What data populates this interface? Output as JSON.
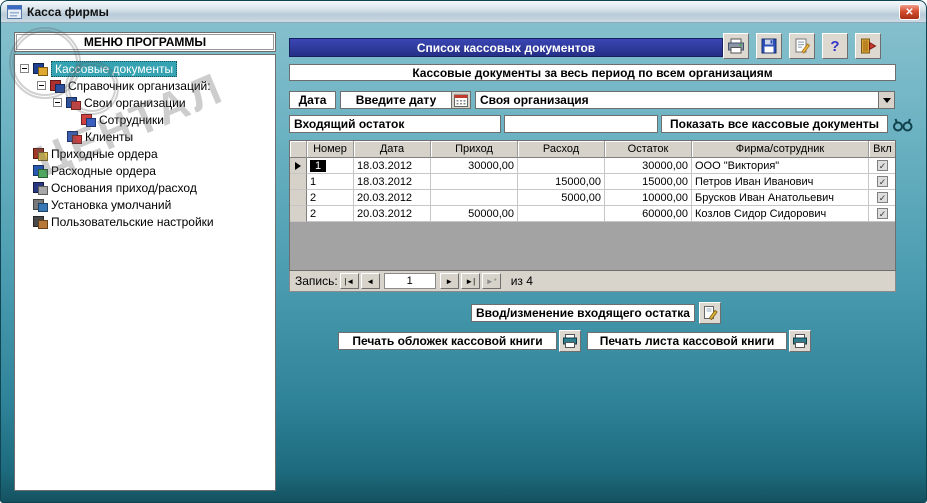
{
  "window": {
    "title": "Касса фирмы",
    "close": "✕"
  },
  "watermark": {
    "text": "ЦЕНТАЛ"
  },
  "colors": {
    "desktop_teal": "#4b9cb0",
    "header_blue": "#2c379f",
    "selection_teal": "#35a3b2",
    "close_red": "#d44e2e"
  },
  "menu": {
    "header": "МЕНЮ ПРОГРАММЫ",
    "items": [
      {
        "label": "Кассовые документы"
      },
      {
        "label": "Справочник организаций:"
      },
      {
        "label": "Свои организации"
      },
      {
        "label": "Сотрудники"
      },
      {
        "label": "Клиенты"
      },
      {
        "label": "Приходные ордера"
      },
      {
        "label": "Расходные ордера"
      },
      {
        "label": "Основания приход/расход"
      },
      {
        "label": "Установка умолчаний"
      },
      {
        "label": "Пользовательские настройки"
      }
    ]
  },
  "toolbar": {
    "icons": [
      "print",
      "save",
      "form-edit",
      "help",
      "exit"
    ],
    "help_glyph": "?"
  },
  "main": {
    "list_header": "Список кассовых документов",
    "period_header": "Кассовые документы за весь период по всем организациям",
    "filters": {
      "date_label": "Дата",
      "date_value": "Введите дату",
      "org_value": "Своя организация",
      "incoming_label": "Входящий остаток",
      "incoming_value": "",
      "show_all_label": "Показать все кассовые документы"
    },
    "table": {
      "columns": [
        "Номер",
        "Дата",
        "Приход",
        "Расход",
        "Остаток",
        "Фирма/сотрудник",
        "Вкл"
      ],
      "rows": [
        {
          "num": "1",
          "date": "18.03.2012",
          "in": "30000,00",
          "out": "",
          "balance": "30000,00",
          "firm": "ООО \"Виктория\"",
          "on": "✓"
        },
        {
          "num": "1",
          "date": "18.03.2012",
          "in": "",
          "out": "15000,00",
          "balance": "15000,00",
          "firm": "Петров Иван Иванович",
          "on": "✓"
        },
        {
          "num": "2",
          "date": "20.03.2012",
          "in": "",
          "out": "5000,00",
          "balance": "10000,00",
          "firm": "Брусков Иван Анатольевич",
          "on": "✓"
        },
        {
          "num": "2",
          "date": "20.03.2012",
          "in": "50000,00",
          "out": "",
          "balance": "60000,00",
          "firm": "Козлов Сидор Сидорович",
          "on": "✓"
        }
      ]
    },
    "record_nav": {
      "label": "Запись:",
      "first": "|◄",
      "prev": "◄",
      "value": "1",
      "next": "►",
      "last": "►|",
      "new": "►*",
      "count": "из 4"
    },
    "buttons": {
      "balance": "Ввод/изменение входящего остатка",
      "print_cover": "Печать обложек кассовой книги",
      "print_sheet": "Печать листа кассовой книги"
    }
  }
}
